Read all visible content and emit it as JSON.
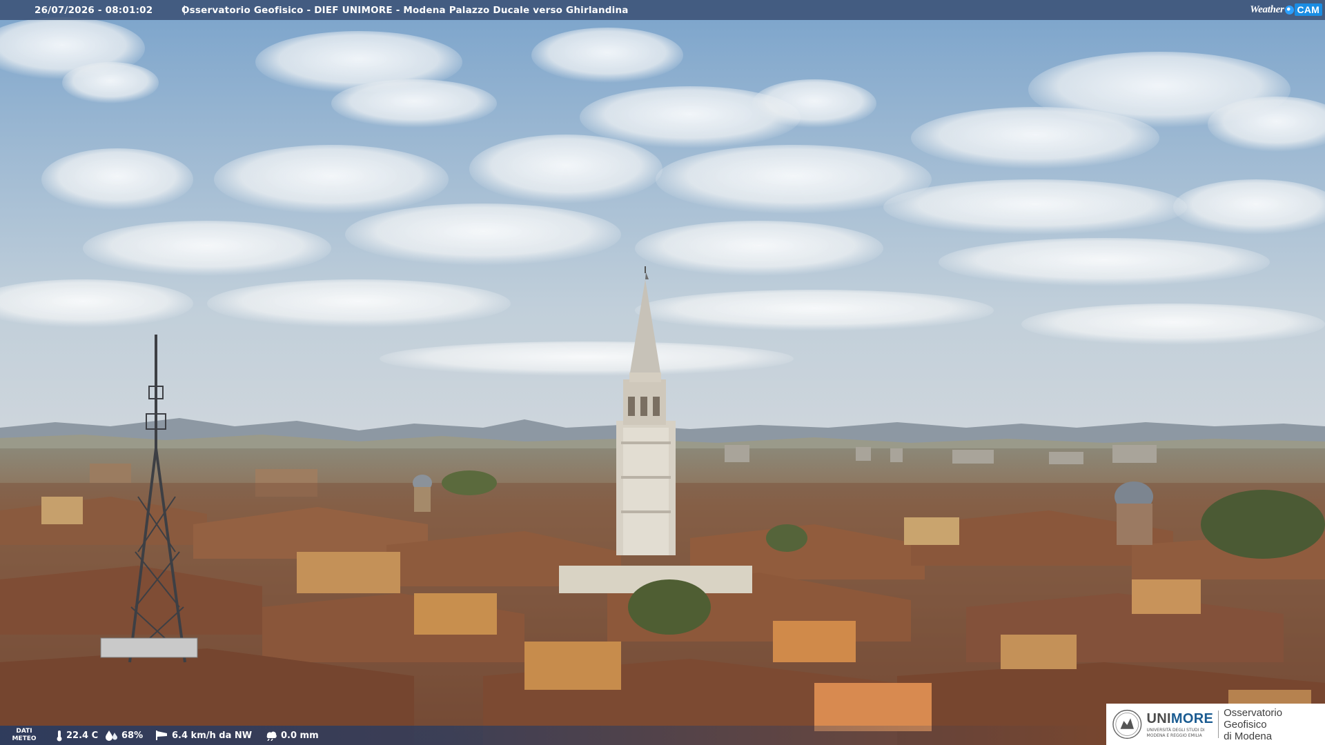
{
  "header": {
    "timestamp": "26/07/2026 - 08:01:02",
    "separator": "|",
    "camera_title": "Osservatorio Geofisico - DIEF UNIMORE - Modena Palazzo Ducale verso Ghirlandina",
    "logo_text_a": "Weather",
    "logo_text_b": "CAM"
  },
  "meteo": {
    "label_line1": "DATI",
    "label_line2": "METEO",
    "temperature": "22.4 C",
    "humidity": "68%",
    "wind": "6.4 km/h da NW",
    "rain": "0.0 mm"
  },
  "footer_logo": {
    "brand_prefix": "UNI",
    "brand_highlight": "MORE",
    "brand_sub_1": "UNIVERSITÀ DEGLI STUDI DI",
    "brand_sub_2": "MODENA E REGGIO EMILIA",
    "observatory_line1": "Osservatorio Geofisico",
    "observatory_line2": "di Modena"
  },
  "colors": {
    "sky_top": "#7fa6cc",
    "sky_bottom": "#c9d4dc",
    "roof": "#8a5a3e",
    "wall_ochre": "#c99455",
    "tower_stone": "#d8d2c6",
    "overlay_bar": "#3a5074",
    "brand_blue": "#1a5b91"
  }
}
